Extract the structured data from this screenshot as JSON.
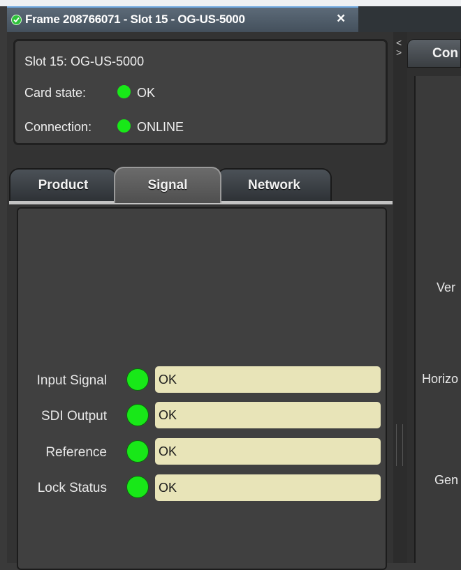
{
  "window": {
    "title": "Frame 208766071 - Slot 15 - OG-US-5000",
    "close_glyph": "×"
  },
  "info": {
    "slot": "Slot 15: OG-US-5000",
    "card_state_label": "Card state:",
    "card_state_value": "OK",
    "connection_label": "Connection:",
    "connection_value": "ONLINE"
  },
  "tabs": [
    {
      "label": "Product"
    },
    {
      "label": "Signal"
    },
    {
      "label": "Network"
    }
  ],
  "signal": {
    "rows": [
      {
        "label": "Input Signal",
        "value": "OK"
      },
      {
        "label": "SDI Output",
        "value": "OK"
      },
      {
        "label": "Reference",
        "value": "OK"
      },
      {
        "label": "Lock Status",
        "value": "OK"
      }
    ]
  },
  "right": {
    "tab_label": "Con",
    "labels": [
      "Ver",
      "Horizo",
      "Gen"
    ],
    "collapse_glyph": "<",
    "expand_glyph": ">"
  },
  "colors": {
    "led_ok": "#18e818",
    "field_bg": "#e8e4b8",
    "tab_active_border": "#6fa8e0"
  }
}
